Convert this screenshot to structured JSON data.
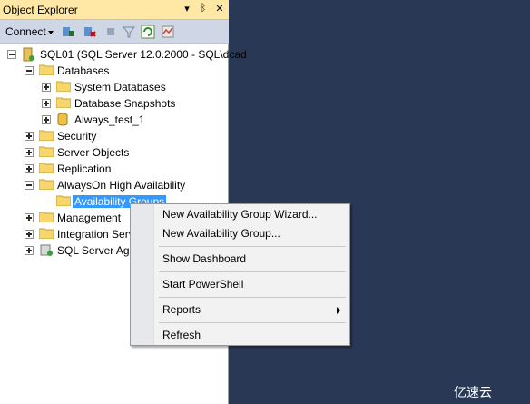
{
  "panel": {
    "title": "Object Explorer",
    "pin_glyph": "▾ ᛒ ✕"
  },
  "toolbar": {
    "connect_label": "Connect",
    "icons": [
      "connect-object-explorer-icon",
      "disconnect-icon",
      "stop-icon",
      "filter-icon",
      "refresh-icon",
      "activity-monitor-icon"
    ]
  },
  "tree": {
    "server": "SQL01 (SQL Server 12.0.2000 - SQL\\dcad",
    "databases": "Databases",
    "system_databases": "System Databases",
    "database_snapshots": "Database Snapshots",
    "always_test": "Always_test_1",
    "security": "Security",
    "server_objects": "Server Objects",
    "replication": "Replication",
    "alwayson": "AlwaysOn High Availability",
    "availability_groups": "Availability Groups",
    "management": "Management",
    "integration_services": "Integration Servi",
    "sql_server_agent": "SQL Server Age"
  },
  "context_menu": {
    "items": [
      "New Availability Group Wizard...",
      "New Availability Group...",
      "Show Dashboard",
      "Start PowerShell",
      "Reports",
      "Refresh"
    ]
  },
  "watermark": "亿速云",
  "colors": {
    "background": "#293955",
    "title_bar": "#ffe8a6",
    "selection": "#3399ff"
  }
}
